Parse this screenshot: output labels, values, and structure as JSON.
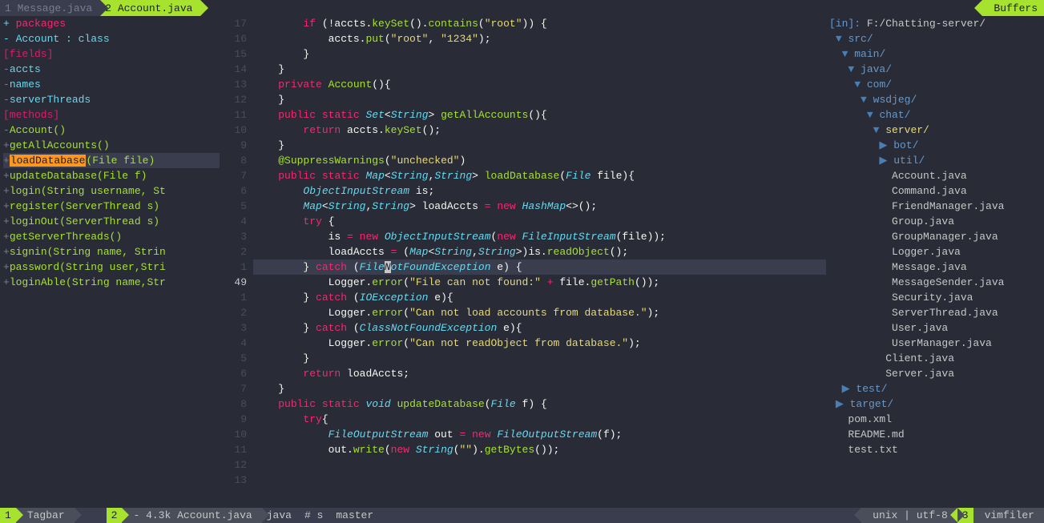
{
  "tabs": {
    "left": [
      {
        "num": "1",
        "label": "Message.java",
        "active": false
      },
      {
        "num": "2",
        "label": "Account.java",
        "active": true
      }
    ],
    "right": "Buffers"
  },
  "tagbar": {
    "lines": [
      {
        "prefix": "+",
        "prefixColor": "tag-cyan",
        "text": " packages",
        "textColor": "tag-red"
      },
      {
        "prefix": "-",
        "prefixColor": "tag-cyan",
        "text": " Account : class",
        "textColor": "tag-cyan"
      },
      {
        "prefix": "  ",
        "text": "  [fields]",
        "textColor": "tag-magenta"
      },
      {
        "prefix": "  -",
        "prefixColor": "tag-gray",
        "text": "accts",
        "textColor": "tag-cyan"
      },
      {
        "prefix": "  -",
        "prefixColor": "tag-gray",
        "text": "names",
        "textColor": "tag-cyan"
      },
      {
        "prefix": "  -",
        "prefixColor": "tag-gray",
        "text": "serverThreads",
        "textColor": "tag-cyan"
      },
      {
        "prefix": "  ",
        "text": "  [methods]",
        "textColor": "tag-magenta"
      },
      {
        "prefix": "  -",
        "prefixColor": "tag-gray",
        "text": "Account()",
        "textColor": "tag-green"
      },
      {
        "prefix": "  +",
        "prefixColor": "tag-gray",
        "text": "getAllAccounts()",
        "textColor": "tag-green"
      },
      {
        "prefix": "  +",
        "prefixColor": "tag-gray",
        "highlight": "loadDatabase",
        "text": "(File file)",
        "textColor": "tag-green"
      },
      {
        "prefix": "  +",
        "prefixColor": "tag-gray",
        "text": "updateDatabase(File f)",
        "textColor": "tag-green"
      },
      {
        "prefix": "  +",
        "prefixColor": "tag-gray",
        "text": "login(String username, St",
        "textColor": "tag-green"
      },
      {
        "prefix": "  +",
        "prefixColor": "tag-gray",
        "text": "register(ServerThread s)",
        "textColor": "tag-green"
      },
      {
        "prefix": "  +",
        "prefixColor": "tag-gray",
        "text": "loginOut(ServerThread s)",
        "textColor": "tag-green"
      },
      {
        "prefix": "  +",
        "prefixColor": "tag-gray",
        "text": "getServerThreads()",
        "textColor": "tag-green"
      },
      {
        "prefix": "  +",
        "prefixColor": "tag-gray",
        "text": "signin(String name, Strin",
        "textColor": "tag-green"
      },
      {
        "prefix": "  +",
        "prefixColor": "tag-gray",
        "text": "password(String user,Stri",
        "textColor": "tag-green"
      },
      {
        "prefix": "  +",
        "prefixColor": "tag-gray",
        "text": "loginAble(String name,Str",
        "textColor": "tag-green"
      }
    ]
  },
  "gutter": [
    "17",
    "16",
    "15",
    "14",
    "13",
    "12",
    "11",
    "10",
    "9",
    "8",
    "7",
    "6",
    "5",
    "4",
    "3",
    "2",
    "1",
    "49",
    "1",
    "2",
    "3",
    "4",
    "5",
    "6",
    "7",
    "8",
    "9",
    "10",
    "11",
    "12",
    "13"
  ],
  "currentLine": 17,
  "code": [
    "        <kw>if</kw> (!accts.<fn>keySet</fn>().<fn>contains</fn>(<str>\"root\"</str>)) {",
    "            accts.<fn>put</fn>(<str>\"root\"</str>, <str>\"1234\"</str>);",
    "        }",
    "    }",
    "    <kw>private</kw> <fn>Account</fn>(){",
    "",
    "    }",
    "    <kw>public</kw> <kw>static</kw> <type>Set</type><<type>String</type>> <fn>getAllAccounts</fn>(){",
    "        <kw>return</kw> accts.<fn>keySet</fn>();",
    "    }",
    "    <ann>@SuppressWarnings</ann>(<str>\"unchecked\"</str>)",
    "    <kw>public</kw> <kw>static</kw> <type>Map</type><<type>String</type>,<type>String</type>> <fn>loadDatabase</fn>(<type>File</type> file){",
    "        <type>ObjectInputStream</type> is;",
    "        <type>Map</type><<type>String</type>,<type>String</type>> loadAccts <kw>=</kw> <kw>new</kw> <type>HashMap</type><>();",
    "        <kw>try</kw> {",
    "            is <kw>=</kw> <kw>new</kw> <type>ObjectInputStream</type>(<kw>new</kw> <type>FileInputStream</type>(file));",
    "            loadAccts <kw>=</kw> (<type>Map</type><<type>String</type>,<type>String</type>>)is.<fn>readObject</fn>();",
    "        } <kw>catch</kw> (<type>File<cur>N</cur>otFoundException</type> e) {",
    "            Logger.<fn>error</fn>(<str>\"File can not found:\"</str> <kw>+</kw> file.<fn>getPath</fn>());",
    "        } <kw>catch</kw> (<type>IOException</type> e){",
    "            Logger.<fn>error</fn>(<str>\"Can not load accounts from database.\"</str>);",
    "        } <kw>catch</kw> (<type>ClassNotFoundException</type> e){",
    "            Logger.<fn>error</fn>(<str>\"Can not readObject from database.\"</str>);",
    "        }",
    "        <kw>return</kw> loadAccts;",
    "    }",
    "",
    "    <kw>public</kw> <kw>static</kw> <type>void</type> <fn>updateDatabase</fn>(<type>File</type> f) {",
    "        <kw>try</kw>{",
    "            <type>FileOutputStream</type> out <kw>=</kw> <kw>new</kw> <type>FileOutputStream</type>(f);",
    "            out.<fn>write</fn>(<kw>new</kw> <type>String</type>(<str>\"\"</str>).<fn>getBytes</fn>());"
  ],
  "filetree": {
    "header": {
      "label": "[in]:",
      "path": "F:/Chatting-server/"
    },
    "items": [
      {
        "indent": 0,
        "arrow": "▼",
        "text": "src/",
        "color": "ft-blue"
      },
      {
        "indent": 1,
        "arrow": "▼",
        "text": "main/",
        "color": "ft-blue"
      },
      {
        "indent": 2,
        "arrow": "▼",
        "text": "java/",
        "color": "ft-blue"
      },
      {
        "indent": 3,
        "arrow": "▼",
        "text": "com/",
        "color": "ft-blue"
      },
      {
        "indent": 4,
        "arrow": "▼",
        "text": "wsdjeg/",
        "color": "ft-blue"
      },
      {
        "indent": 5,
        "arrow": "▼",
        "text": "chat/",
        "color": "ft-blue"
      },
      {
        "indent": 6,
        "arrow": "▼",
        "text": "server/",
        "color": "ft-yellow"
      },
      {
        "indent": 7,
        "arrow": "▶",
        "text": "bot/",
        "color": "ft-blue"
      },
      {
        "indent": 7,
        "arrow": "▶",
        "text": "util/",
        "color": "ft-blue"
      },
      {
        "indent": 7,
        "text": "Account.java",
        "color": "ft-gray"
      },
      {
        "indent": 7,
        "text": "Command.java",
        "color": "ft-gray"
      },
      {
        "indent": 7,
        "text": "FriendManager.java",
        "color": "ft-gray"
      },
      {
        "indent": 7,
        "text": "Group.java",
        "color": "ft-gray"
      },
      {
        "indent": 7,
        "text": "GroupManager.java",
        "color": "ft-gray"
      },
      {
        "indent": 7,
        "text": "Logger.java",
        "color": "ft-gray"
      },
      {
        "indent": 7,
        "text": "Message.java",
        "color": "ft-gray"
      },
      {
        "indent": 7,
        "text": "MessageSender.java",
        "color": "ft-gray"
      },
      {
        "indent": 7,
        "text": "Security.java",
        "color": "ft-gray"
      },
      {
        "indent": 7,
        "text": "ServerThread.java",
        "color": "ft-gray"
      },
      {
        "indent": 7,
        "text": "User.java",
        "color": "ft-gray"
      },
      {
        "indent": 7,
        "text": "UserManager.java",
        "color": "ft-gray"
      },
      {
        "indent": 6,
        "text": "Client.java",
        "color": "ft-gray"
      },
      {
        "indent": 6,
        "text": "Server.java",
        "color": "ft-gray"
      },
      {
        "indent": 1,
        "arrow": "▶",
        "text": "test/",
        "color": "ft-blue"
      },
      {
        "indent": 0,
        "arrow": "▶",
        "text": "target/",
        "color": "ft-blue"
      },
      {
        "indent": 0,
        "text": "pom.xml",
        "color": "ft-gray"
      },
      {
        "indent": 0,
        "text": "README.md",
        "color": "ft-gray"
      },
      {
        "indent": 0,
        "text": "test.txt",
        "color": "ft-gray"
      }
    ]
  },
  "statusbar": {
    "left": {
      "num": "1",
      "label": "Tagbar"
    },
    "center": {
      "num": "2",
      "modified": "-",
      "size": "4.3k",
      "file": "Account.java",
      "lang": "java",
      "branch_icon": "# s",
      "branch": "master"
    },
    "right_info": "unix | utf-8",
    "right": {
      "num": "3",
      "label": "vimfiler"
    }
  }
}
